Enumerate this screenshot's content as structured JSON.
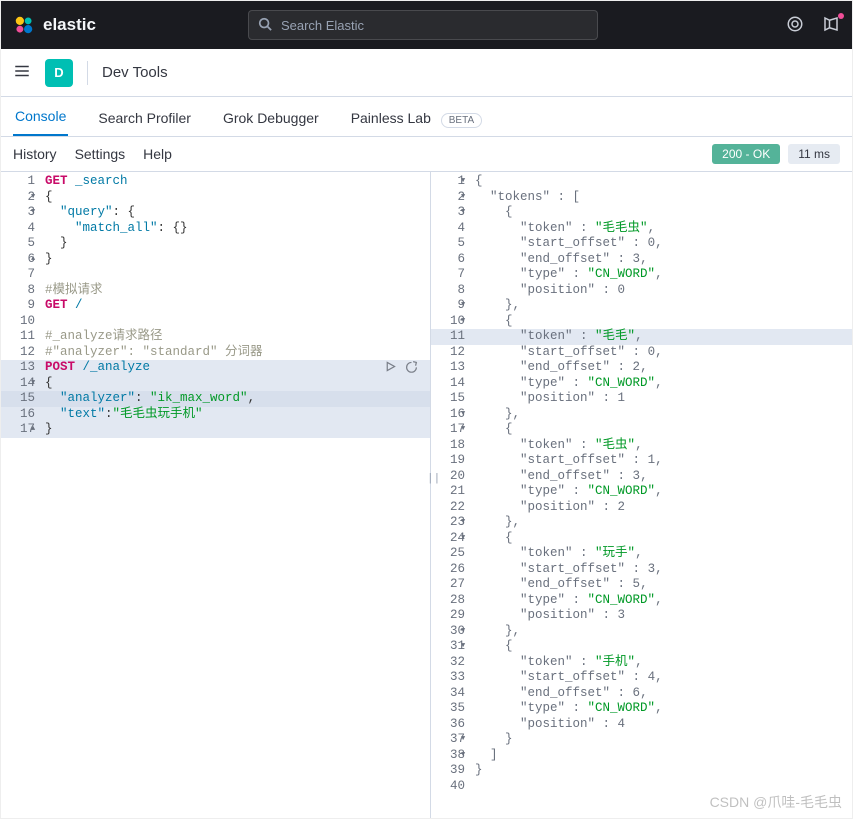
{
  "topnav": {
    "brand": "elastic",
    "search_placeholder": "Search Elastic"
  },
  "appbar": {
    "icon_letter": "D",
    "title": "Dev Tools"
  },
  "tabs": {
    "console": "Console",
    "profiler": "Search Profiler",
    "grok": "Grok Debugger",
    "painless": "Painless Lab",
    "beta": "BETA"
  },
  "toolbar": {
    "history": "History",
    "settings": "Settings",
    "help": "Help",
    "status": "200 - OK",
    "time": "11 ms"
  },
  "request_lines": [
    {
      "n": 1,
      "fold": "",
      "segs": [
        {
          "t": "GET ",
          "c": "k-method"
        },
        {
          "t": "_search",
          "c": "k-key"
        }
      ]
    },
    {
      "n": 2,
      "fold": "▾",
      "segs": [
        {
          "t": "{",
          "c": "k-punc"
        }
      ]
    },
    {
      "n": 3,
      "fold": "▾",
      "segs": [
        {
          "t": "  ",
          "c": ""
        },
        {
          "t": "\"query\"",
          "c": "k-key"
        },
        {
          "t": ": {",
          "c": "k-punc"
        }
      ]
    },
    {
      "n": 4,
      "fold": "",
      "segs": [
        {
          "t": "    ",
          "c": ""
        },
        {
          "t": "\"match_all\"",
          "c": "k-key"
        },
        {
          "t": ": {}",
          "c": "k-punc"
        }
      ]
    },
    {
      "n": 5,
      "fold": "",
      "segs": [
        {
          "t": "  }",
          "c": "k-punc"
        }
      ]
    },
    {
      "n": 6,
      "fold": "▴",
      "segs": [
        {
          "t": "}",
          "c": "k-punc"
        }
      ]
    },
    {
      "n": 7,
      "fold": "",
      "segs": []
    },
    {
      "n": 8,
      "fold": "",
      "segs": [
        {
          "t": "#模拟请求",
          "c": "k-com"
        }
      ]
    },
    {
      "n": 9,
      "fold": "",
      "segs": [
        {
          "t": "GET ",
          "c": "k-method"
        },
        {
          "t": "/",
          "c": "k-key"
        }
      ]
    },
    {
      "n": 10,
      "fold": "",
      "segs": []
    },
    {
      "n": 11,
      "fold": "",
      "segs": [
        {
          "t": "#_analyze请求路径",
          "c": "k-com"
        }
      ]
    },
    {
      "n": 12,
      "fold": "",
      "segs": [
        {
          "t": "#\"analyzer\": \"standard\" 分词器",
          "c": "k-com"
        }
      ]
    },
    {
      "n": 13,
      "fold": "",
      "hl": true,
      "run": true,
      "segs": [
        {
          "t": "POST ",
          "c": "k-method"
        },
        {
          "t": "/_analyze",
          "c": "k-key"
        }
      ]
    },
    {
      "n": 14,
      "fold": "▾",
      "hl": true,
      "segs": [
        {
          "t": "{",
          "c": "k-punc"
        }
      ]
    },
    {
      "n": 15,
      "fold": "",
      "hl": true,
      "strong": true,
      "segs": [
        {
          "t": "  ",
          "c": ""
        },
        {
          "t": "\"analyzer\"",
          "c": "k-key"
        },
        {
          "t": ": ",
          "c": "k-punc"
        },
        {
          "t": "\"ik_max_word\"",
          "c": "k-str"
        },
        {
          "t": ",",
          "c": "k-punc"
        }
      ]
    },
    {
      "n": 16,
      "fold": "",
      "hl": true,
      "segs": [
        {
          "t": "  ",
          "c": ""
        },
        {
          "t": "\"text\"",
          "c": "k-key"
        },
        {
          "t": ":",
          "c": "k-punc"
        },
        {
          "t": "\"毛毛虫玩手机\"",
          "c": "k-str"
        }
      ]
    },
    {
      "n": 17,
      "fold": "▴",
      "hl": true,
      "segs": [
        {
          "t": "}",
          "c": "k-punc"
        }
      ]
    }
  ],
  "response_lines": [
    {
      "n": 1,
      "fold": "▾",
      "segs": [
        {
          "t": "{",
          "c": "k-punc"
        }
      ]
    },
    {
      "n": 2,
      "fold": "▾",
      "segs": [
        {
          "t": "  ",
          "c": ""
        },
        {
          "t": "\"tokens\"",
          "c": "k-key"
        },
        {
          "t": " : [",
          "c": "k-punc"
        }
      ]
    },
    {
      "n": 3,
      "fold": "▾",
      "segs": [
        {
          "t": "    {",
          "c": "k-punc"
        }
      ]
    },
    {
      "n": 4,
      "fold": "",
      "segs": [
        {
          "t": "      ",
          "c": ""
        },
        {
          "t": "\"token\"",
          "c": "k-key"
        },
        {
          "t": " : ",
          "c": "k-punc"
        },
        {
          "t": "\"毛毛虫\"",
          "c": "k-str"
        },
        {
          "t": ",",
          "c": "k-punc"
        }
      ]
    },
    {
      "n": 5,
      "fold": "",
      "segs": [
        {
          "t": "      ",
          "c": ""
        },
        {
          "t": "\"start_offset\"",
          "c": "k-key"
        },
        {
          "t": " : ",
          "c": "k-punc"
        },
        {
          "t": "0",
          "c": "k-num"
        },
        {
          "t": ",",
          "c": "k-punc"
        }
      ]
    },
    {
      "n": 6,
      "fold": "",
      "segs": [
        {
          "t": "      ",
          "c": ""
        },
        {
          "t": "\"end_offset\"",
          "c": "k-key"
        },
        {
          "t": " : ",
          "c": "k-punc"
        },
        {
          "t": "3",
          "c": "k-num"
        },
        {
          "t": ",",
          "c": "k-punc"
        }
      ]
    },
    {
      "n": 7,
      "fold": "",
      "segs": [
        {
          "t": "      ",
          "c": ""
        },
        {
          "t": "\"type\"",
          "c": "k-key"
        },
        {
          "t": " : ",
          "c": "k-punc"
        },
        {
          "t": "\"CN_WORD\"",
          "c": "k-str"
        },
        {
          "t": ",",
          "c": "k-punc"
        }
      ]
    },
    {
      "n": 8,
      "fold": "",
      "segs": [
        {
          "t": "      ",
          "c": ""
        },
        {
          "t": "\"position\"",
          "c": "k-key"
        },
        {
          "t": " : ",
          "c": "k-punc"
        },
        {
          "t": "0",
          "c": "k-num"
        }
      ]
    },
    {
      "n": 9,
      "fold": "▾",
      "segs": [
        {
          "t": "    },",
          "c": "k-punc"
        }
      ]
    },
    {
      "n": 10,
      "fold": "▾",
      "segs": [
        {
          "t": "    {",
          "c": "k-punc"
        }
      ]
    },
    {
      "n": 11,
      "fold": "",
      "hl": true,
      "segs": [
        {
          "t": "      ",
          "c": ""
        },
        {
          "t": "\"token\"",
          "c": "k-key"
        },
        {
          "t": " : ",
          "c": "k-punc"
        },
        {
          "t": "\"毛毛\"",
          "c": "k-str"
        },
        {
          "t": ",",
          "c": "k-punc"
        }
      ]
    },
    {
      "n": 12,
      "fold": "",
      "segs": [
        {
          "t": "      ",
          "c": ""
        },
        {
          "t": "\"start_offset\"",
          "c": "k-key"
        },
        {
          "t": " : ",
          "c": "k-punc"
        },
        {
          "t": "0",
          "c": "k-num"
        },
        {
          "t": ",",
          "c": "k-punc"
        }
      ]
    },
    {
      "n": 13,
      "fold": "",
      "segs": [
        {
          "t": "      ",
          "c": ""
        },
        {
          "t": "\"end_offset\"",
          "c": "k-key"
        },
        {
          "t": " : ",
          "c": "k-punc"
        },
        {
          "t": "2",
          "c": "k-num"
        },
        {
          "t": ",",
          "c": "k-punc"
        }
      ]
    },
    {
      "n": 14,
      "fold": "",
      "segs": [
        {
          "t": "      ",
          "c": ""
        },
        {
          "t": "\"type\"",
          "c": "k-key"
        },
        {
          "t": " : ",
          "c": "k-punc"
        },
        {
          "t": "\"CN_WORD\"",
          "c": "k-str"
        },
        {
          "t": ",",
          "c": "k-punc"
        }
      ]
    },
    {
      "n": 15,
      "fold": "",
      "segs": [
        {
          "t": "      ",
          "c": ""
        },
        {
          "t": "\"position\"",
          "c": "k-key"
        },
        {
          "t": " : ",
          "c": "k-punc"
        },
        {
          "t": "1",
          "c": "k-num"
        }
      ]
    },
    {
      "n": 16,
      "fold": "▾",
      "segs": [
        {
          "t": "    },",
          "c": "k-punc"
        }
      ]
    },
    {
      "n": 17,
      "fold": "▾",
      "segs": [
        {
          "t": "    {",
          "c": "k-punc"
        }
      ]
    },
    {
      "n": 18,
      "fold": "",
      "segs": [
        {
          "t": "      ",
          "c": ""
        },
        {
          "t": "\"token\"",
          "c": "k-key"
        },
        {
          "t": " : ",
          "c": "k-punc"
        },
        {
          "t": "\"毛虫\"",
          "c": "k-str"
        },
        {
          "t": ",",
          "c": "k-punc"
        }
      ]
    },
    {
      "n": 19,
      "fold": "",
      "segs": [
        {
          "t": "      ",
          "c": ""
        },
        {
          "t": "\"start_offset\"",
          "c": "k-key"
        },
        {
          "t": " : ",
          "c": "k-punc"
        },
        {
          "t": "1",
          "c": "k-num"
        },
        {
          "t": ",",
          "c": "k-punc"
        }
      ]
    },
    {
      "n": 20,
      "fold": "",
      "segs": [
        {
          "t": "      ",
          "c": ""
        },
        {
          "t": "\"end_offset\"",
          "c": "k-key"
        },
        {
          "t": " : ",
          "c": "k-punc"
        },
        {
          "t": "3",
          "c": "k-num"
        },
        {
          "t": ",",
          "c": "k-punc"
        }
      ]
    },
    {
      "n": 21,
      "fold": "",
      "segs": [
        {
          "t": "      ",
          "c": ""
        },
        {
          "t": "\"type\"",
          "c": "k-key"
        },
        {
          "t": " : ",
          "c": "k-punc"
        },
        {
          "t": "\"CN_WORD\"",
          "c": "k-str"
        },
        {
          "t": ",",
          "c": "k-punc"
        }
      ]
    },
    {
      "n": 22,
      "fold": "",
      "segs": [
        {
          "t": "      ",
          "c": ""
        },
        {
          "t": "\"position\"",
          "c": "k-key"
        },
        {
          "t": " : ",
          "c": "k-punc"
        },
        {
          "t": "2",
          "c": "k-num"
        }
      ]
    },
    {
      "n": 23,
      "fold": "▾",
      "segs": [
        {
          "t": "    },",
          "c": "k-punc"
        }
      ]
    },
    {
      "n": 24,
      "fold": "▾",
      "segs": [
        {
          "t": "    {",
          "c": "k-punc"
        }
      ]
    },
    {
      "n": 25,
      "fold": "",
      "segs": [
        {
          "t": "      ",
          "c": ""
        },
        {
          "t": "\"token\"",
          "c": "k-key"
        },
        {
          "t": " : ",
          "c": "k-punc"
        },
        {
          "t": "\"玩手\"",
          "c": "k-str"
        },
        {
          "t": ",",
          "c": "k-punc"
        }
      ]
    },
    {
      "n": 26,
      "fold": "",
      "segs": [
        {
          "t": "      ",
          "c": ""
        },
        {
          "t": "\"start_offset\"",
          "c": "k-key"
        },
        {
          "t": " : ",
          "c": "k-punc"
        },
        {
          "t": "3",
          "c": "k-num"
        },
        {
          "t": ",",
          "c": "k-punc"
        }
      ]
    },
    {
      "n": 27,
      "fold": "",
      "segs": [
        {
          "t": "      ",
          "c": ""
        },
        {
          "t": "\"end_offset\"",
          "c": "k-key"
        },
        {
          "t": " : ",
          "c": "k-punc"
        },
        {
          "t": "5",
          "c": "k-num"
        },
        {
          "t": ",",
          "c": "k-punc"
        }
      ]
    },
    {
      "n": 28,
      "fold": "",
      "segs": [
        {
          "t": "      ",
          "c": ""
        },
        {
          "t": "\"type\"",
          "c": "k-key"
        },
        {
          "t": " : ",
          "c": "k-punc"
        },
        {
          "t": "\"CN_WORD\"",
          "c": "k-str"
        },
        {
          "t": ",",
          "c": "k-punc"
        }
      ]
    },
    {
      "n": 29,
      "fold": "",
      "segs": [
        {
          "t": "      ",
          "c": ""
        },
        {
          "t": "\"position\"",
          "c": "k-key"
        },
        {
          "t": " : ",
          "c": "k-punc"
        },
        {
          "t": "3",
          "c": "k-num"
        }
      ]
    },
    {
      "n": 30,
      "fold": "▾",
      "segs": [
        {
          "t": "    },",
          "c": "k-punc"
        }
      ]
    },
    {
      "n": 31,
      "fold": "▾",
      "segs": [
        {
          "t": "    {",
          "c": "k-punc"
        }
      ]
    },
    {
      "n": 32,
      "fold": "",
      "segs": [
        {
          "t": "      ",
          "c": ""
        },
        {
          "t": "\"token\"",
          "c": "k-key"
        },
        {
          "t": " : ",
          "c": "k-punc"
        },
        {
          "t": "\"手机\"",
          "c": "k-str"
        },
        {
          "t": ",",
          "c": "k-punc"
        }
      ]
    },
    {
      "n": 33,
      "fold": "",
      "segs": [
        {
          "t": "      ",
          "c": ""
        },
        {
          "t": "\"start_offset\"",
          "c": "k-key"
        },
        {
          "t": " : ",
          "c": "k-punc"
        },
        {
          "t": "4",
          "c": "k-num"
        },
        {
          "t": ",",
          "c": "k-punc"
        }
      ]
    },
    {
      "n": 34,
      "fold": "",
      "segs": [
        {
          "t": "      ",
          "c": ""
        },
        {
          "t": "\"end_offset\"",
          "c": "k-key"
        },
        {
          "t": " : ",
          "c": "k-punc"
        },
        {
          "t": "6",
          "c": "k-num"
        },
        {
          "t": ",",
          "c": "k-punc"
        }
      ]
    },
    {
      "n": 35,
      "fold": "",
      "segs": [
        {
          "t": "      ",
          "c": ""
        },
        {
          "t": "\"type\"",
          "c": "k-key"
        },
        {
          "t": " : ",
          "c": "k-punc"
        },
        {
          "t": "\"CN_WORD\"",
          "c": "k-str"
        },
        {
          "t": ",",
          "c": "k-punc"
        }
      ]
    },
    {
      "n": 36,
      "fold": "",
      "segs": [
        {
          "t": "      ",
          "c": ""
        },
        {
          "t": "\"position\"",
          "c": "k-key"
        },
        {
          "t": " : ",
          "c": "k-punc"
        },
        {
          "t": "4",
          "c": "k-num"
        }
      ]
    },
    {
      "n": 37,
      "fold": "▾",
      "segs": [
        {
          "t": "    }",
          "c": "k-punc"
        }
      ]
    },
    {
      "n": 38,
      "fold": "▾",
      "segs": [
        {
          "t": "  ]",
          "c": "k-punc"
        }
      ]
    },
    {
      "n": 39,
      "fold": "",
      "segs": [
        {
          "t": "}",
          "c": "k-punc"
        }
      ]
    },
    {
      "n": 40,
      "fold": "",
      "segs": []
    }
  ],
  "watermark": "CSDN @爪哇-毛毛虫"
}
